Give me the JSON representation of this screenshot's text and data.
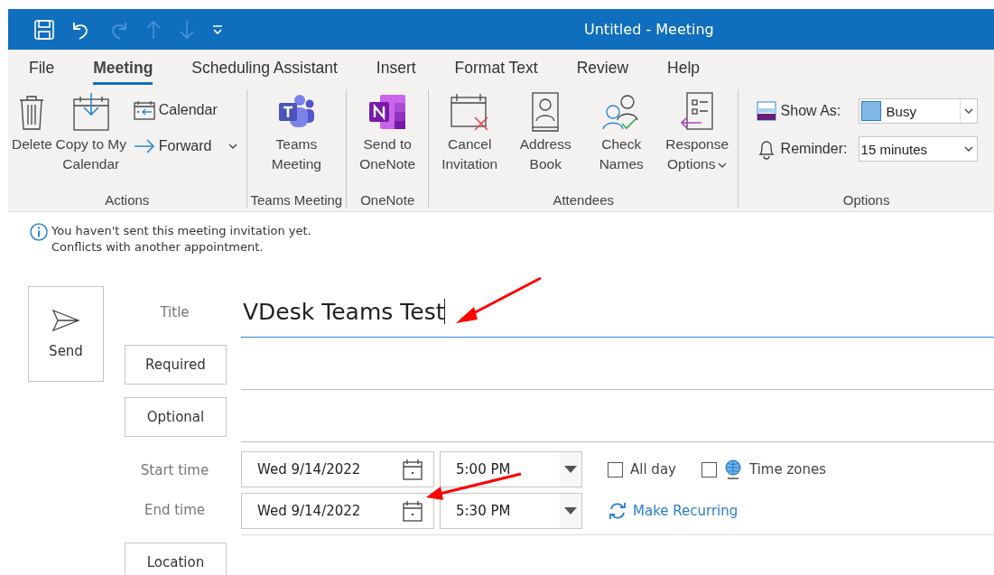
{
  "window": {
    "title": "Untitled - Meeting"
  },
  "quick_access": [
    {
      "kind": "save",
      "disabled": false
    },
    {
      "kind": "undo",
      "disabled": false
    },
    {
      "kind": "redo",
      "disabled": true
    },
    {
      "kind": "up",
      "disabled": true
    },
    {
      "kind": "down",
      "disabled": true
    },
    {
      "kind": "customize",
      "disabled": false
    }
  ],
  "tabs": [
    {
      "label": "File",
      "selected": false
    },
    {
      "label": "Meeting",
      "selected": true
    },
    {
      "label": "Scheduling Assistant",
      "selected": false
    },
    {
      "label": "Insert",
      "selected": false
    },
    {
      "label": "Format Text",
      "selected": false
    },
    {
      "label": "Review",
      "selected": false
    },
    {
      "label": "Help",
      "selected": false
    }
  ],
  "ribbon": {
    "groups": [
      {
        "label": "Actions",
        "buttons": [
          {
            "kind": "trash",
            "label": "Delete",
            "dropdown": false
          },
          {
            "kind": "copyto",
            "label": "Copy to My Calendar",
            "dropdown": false
          }
        ],
        "small_buttons": [
          {
            "kind": "calendar",
            "label": "Calendar",
            "dropdown": false
          },
          {
            "kind": "forward",
            "label": "Forward",
            "dropdown": true
          }
        ]
      },
      {
        "label": "Teams Meeting",
        "buttons": [
          {
            "kind": "teams",
            "label": "Teams Meeting",
            "dropdown": false
          }
        ]
      },
      {
        "label": "OneNote",
        "buttons": [
          {
            "kind": "onenote",
            "label": "Send to OneNote",
            "dropdown": false
          }
        ]
      },
      {
        "label": "Attendees",
        "buttons": [
          {
            "kind": "cancel",
            "label": "Cancel Invitation",
            "dropdown": false
          },
          {
            "kind": "addressbook",
            "label": "Address Book",
            "dropdown": false
          },
          {
            "kind": "checknames",
            "label": "Check Names",
            "dropdown": false
          },
          {
            "kind": "response",
            "label": "Response Options",
            "dropdown": true
          }
        ]
      }
    ],
    "options": {
      "label": "Options",
      "show_as": {
        "label": "Show As:",
        "value": "Busy",
        "color": "#7fb8e6"
      },
      "reminder": {
        "label": "Reminder:",
        "value": "15 minutes"
      }
    }
  },
  "info_bar": {
    "lines": [
      "You haven't sent this meeting invitation yet.",
      "Conflicts with another appointment."
    ]
  },
  "form": {
    "send": "Send",
    "title_label": "Title",
    "title_value": "VDesk Teams Test",
    "required": "Required",
    "optional": "Optional",
    "start_label": "Start time",
    "start_date": "Wed 9/14/2022",
    "start_time": "5:00 PM",
    "end_label": "End time",
    "end_date": "Wed 9/14/2022",
    "end_time": "5:30 PM",
    "all_day": {
      "label": "All day",
      "checked": false
    },
    "time_zones": {
      "label": "Time zones",
      "checked": false
    },
    "make_recurring": "Make Recurring",
    "location": "Location"
  },
  "annotations": [
    {
      "kind": "arrow"
    },
    {
      "kind": "arrow"
    }
  ]
}
